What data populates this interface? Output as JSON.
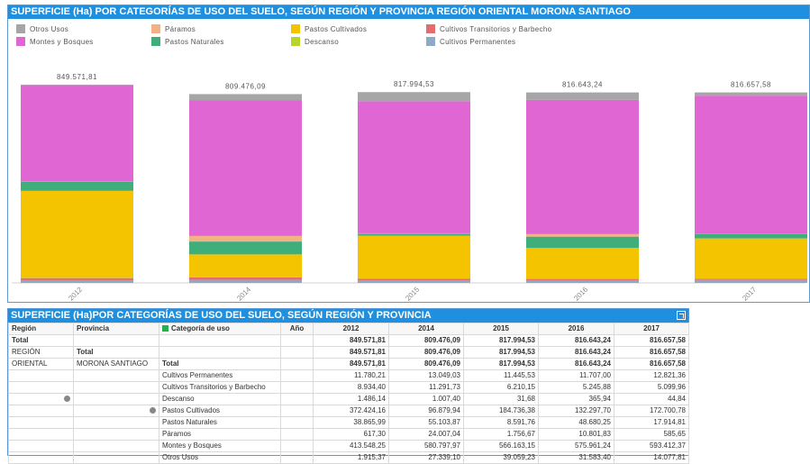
{
  "chart_panel": {
    "title": "SUPERFICIE (Ha) POR CATEGORÍAS DE USO DEL SUELO, SEGÚN REGIÓN Y PROVINCIA REGIÓN ORIENTAL MORONA SANTIAGO"
  },
  "legend": [
    {
      "label": "Otros Usos",
      "color": "#a6a6a6"
    },
    {
      "label": "Páramos",
      "color": "#f4b183"
    },
    {
      "label": "Pastos Cultivados",
      "color": "#f5c400"
    },
    {
      "label": "Cultivos Transitorios y Barbecho",
      "color": "#e46c6c"
    },
    {
      "label": "Montes y Bosques",
      "color": "#e066d4"
    },
    {
      "label": "Pastos Naturales",
      "color": "#3fae7a"
    },
    {
      "label": "Descanso",
      "color": "#b8d62a"
    },
    {
      "label": "Cultivos Permanentes",
      "color": "#8ea9c8"
    }
  ],
  "chart_data": {
    "type": "bar",
    "stacked": true,
    "categories": [
      "2012",
      "2014",
      "2015",
      "2016",
      "2017"
    ],
    "totals_labels": [
      "849.571,81",
      "809.476,09",
      "817.994,53",
      "816.643,24",
      "816.657,58"
    ],
    "series": [
      {
        "name": "Cultivos Permanentes",
        "color": "#8ea9c8",
        "values": [
          11780.21,
          13049.03,
          11445.53,
          11707.0,
          12821.36
        ]
      },
      {
        "name": "Cultivos Transitorios y Barbecho",
        "color": "#e46c6c",
        "values": [
          8934.4,
          11291.73,
          6210.15,
          5245.88,
          5099.96
        ]
      },
      {
        "name": "Descanso",
        "color": "#b8d62a",
        "values": [
          1486.14,
          1007.4,
          31.68,
          365.94,
          44.84
        ]
      },
      {
        "name": "Pastos Cultivados",
        "color": "#f5c400",
        "values": [
          372424.16,
          96879.94,
          184736.38,
          132297.7,
          172700.78
        ]
      },
      {
        "name": "Pastos Naturales",
        "color": "#3fae7a",
        "values": [
          38865.99,
          55103.87,
          8591.76,
          48680.25,
          17914.81
        ]
      },
      {
        "name": "Páramos",
        "color": "#f4b183",
        "values": [
          617.3,
          24007.04,
          1756.67,
          10801.83,
          585.65
        ]
      },
      {
        "name": "Montes y Bosques",
        "color": "#e066d4",
        "values": [
          413548.25,
          580797.97,
          566163.15,
          575961.24,
          593412.37
        ]
      },
      {
        "name": "Otros Usos",
        "color": "#a6a6a6",
        "values": [
          1915.37,
          27339.1,
          39059.23,
          31583.4,
          14077.81
        ]
      }
    ],
    "ylim": [
      0,
      900000
    ],
    "grid": false,
    "legend_position": "top-left"
  },
  "table_panel": {
    "title": "SUPERFICIE (Ha)POR CATEGORÍAS DE USO DEL SUELO, SEGÚN REGIÓN Y PROVINCIA",
    "headers": {
      "region": "Región",
      "provincia": "Provincia",
      "categoria": "Categoría de uso",
      "anio": "Año"
    },
    "years": [
      "2012",
      "2014",
      "2015",
      "2016",
      "2017"
    ],
    "total_label": "Total",
    "region_label_1": "REGIÓN",
    "region_label_2": "ORIENTAL",
    "provincia_label": "MORONA SANTIAGO",
    "grand_total": [
      "849.571,81",
      "809.476,09",
      "817.994,53",
      "816.643,24",
      "816.657,58"
    ],
    "rows": [
      {
        "cat": "Cultivos Permanentes",
        "v": [
          "11.780,21",
          "13.049,03",
          "11.445,53",
          "11.707,00",
          "12.821,36"
        ]
      },
      {
        "cat": "Cultivos Transitorios y Barbecho",
        "v": [
          "8.934,40",
          "11.291,73",
          "6.210,15",
          "5.245,88",
          "5.099,96"
        ]
      },
      {
        "cat": "Descanso",
        "v": [
          "1.486,14",
          "1.007,40",
          "31,68",
          "365,94",
          "44,84"
        ]
      },
      {
        "cat": "Pastos Cultivados",
        "v": [
          "372.424,16",
          "96.879,94",
          "184.736,38",
          "132.297,70",
          "172.700,78"
        ]
      },
      {
        "cat": "Pastos Naturales",
        "v": [
          "38.865,99",
          "55.103,87",
          "8.591,76",
          "48.680,25",
          "17.914,81"
        ]
      },
      {
        "cat": "Páramos",
        "v": [
          "617,30",
          "24.007,04",
          "1.756,67",
          "10.801,83",
          "585,65"
        ]
      },
      {
        "cat": "Montes y Bosques",
        "v": [
          "413.548,25",
          "580.797,97",
          "566.163,15",
          "575.961,24",
          "593.412,37"
        ]
      },
      {
        "cat": "Otros Usos",
        "v": [
          "1.915,37",
          "27.339,10",
          "39.059,23",
          "31.583,40",
          "14.077,81"
        ]
      }
    ]
  }
}
